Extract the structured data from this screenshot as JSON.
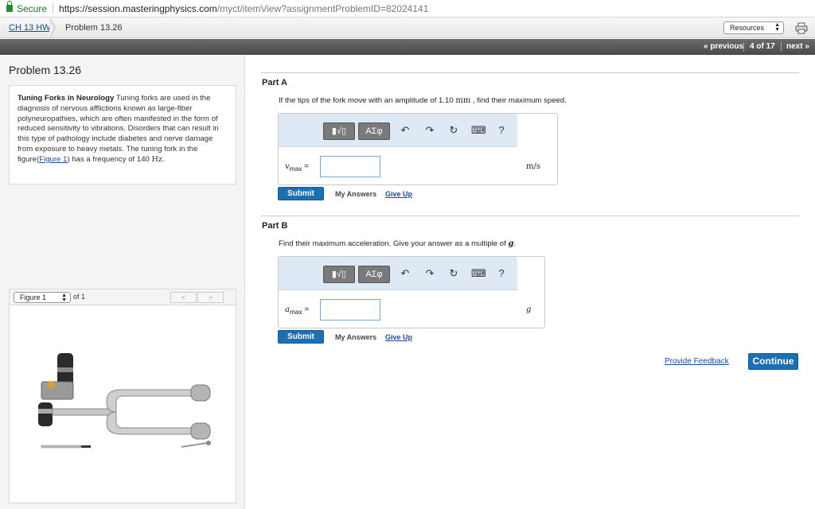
{
  "browser": {
    "secure_label": "Secure",
    "url_host": "https://session.masteringphysics.com",
    "url_path": "/myct/itemView?assignmentProblemID=82024141"
  },
  "breadcrumb": {
    "assignment": "CH 13 HW",
    "problem": "Problem 13.26"
  },
  "header": {
    "resources_label": "Resources",
    "prev_label": "« previous",
    "position": "4 of 17",
    "next_label": "next »"
  },
  "problem": {
    "title": "Problem 13.26",
    "intro_heading": "Tuning Forks in Neurology",
    "intro_text": "Tuning forks are used in the diagnosis of nervous afflictions known as large-fiber polyneuropathies, which are often manifested in the form of reduced sensitivity to vibrations. Disorders that can result in this type of pathology include diabetes and nerve damage from exposure to heavy metals. The tuning fork in the figure(",
    "figure_link": "Figure 1",
    "intro_tail": ") has a frequency of 140",
    "freq_unit": "Hz",
    "intro_end": "."
  },
  "figure": {
    "selector": "Figure 1",
    "of_total": "of 1",
    "prev_label": "<",
    "next_label": ">"
  },
  "toolbar": {
    "templates_label": "▮√▯",
    "symbols_label": "ΑΣφ",
    "help_label": "?"
  },
  "part_a": {
    "label": "Part A",
    "prompt_pre": "If the tips of the fork move with an amplitude of 1.10",
    "prompt_unit": "mm",
    "prompt_post": ", find their maximum speed.",
    "var_symbol": "v",
    "var_sub": "max",
    "equals": "=",
    "input_value": "",
    "unit": "m/s",
    "submit_label": "Submit",
    "my_answers_label": "My Answers",
    "give_up_label": "Give Up"
  },
  "part_b": {
    "label": "Part B",
    "prompt_pre": "Find their maximum acceleration. Give your answer as a multiple of",
    "prompt_var": "g",
    "prompt_post": ".",
    "var_symbol": "a",
    "var_sub": "max",
    "equals": "=",
    "input_value": "",
    "unit": "g",
    "submit_label": "Submit",
    "my_answers_label": "My Answers",
    "give_up_label": "Give Up"
  },
  "footer": {
    "feedback_label": "Provide Feedback",
    "continue_label": "Continue"
  },
  "colors": {
    "accent": "#1b6fb5",
    "link": "#1a4a9c",
    "toolbar_bg": "#dfe9f6",
    "nav_bg": "#555555"
  }
}
